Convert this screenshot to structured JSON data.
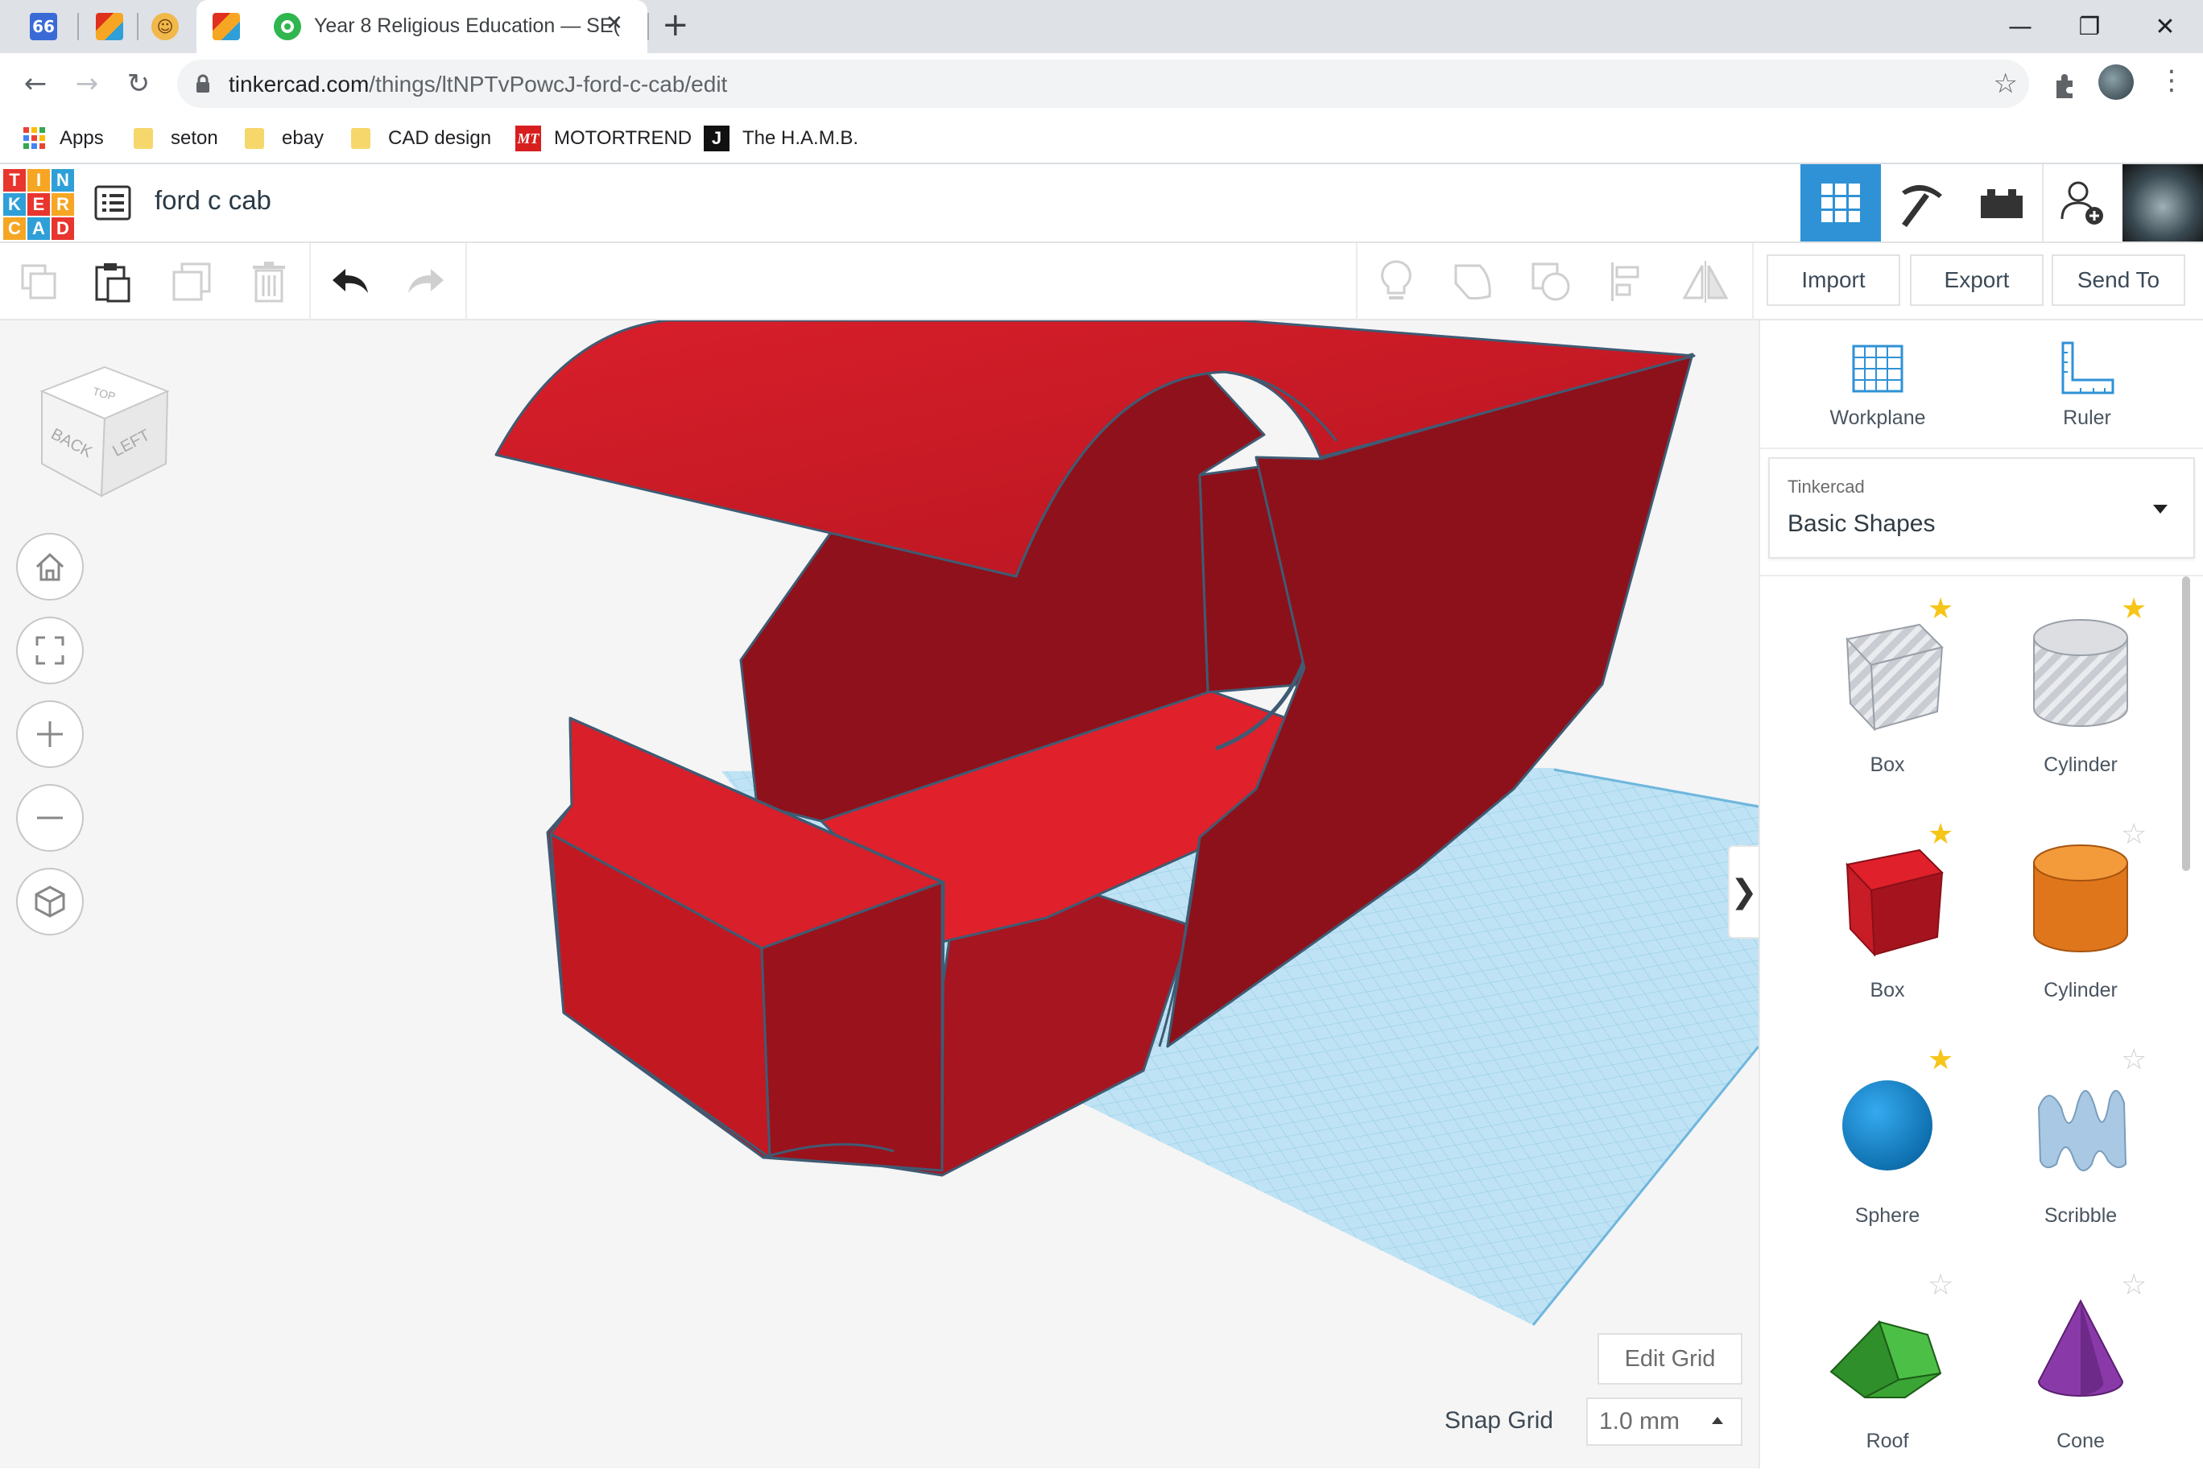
{
  "browser": {
    "tabs": [
      {
        "favicon_text": "66",
        "favicon_color": "#3a6ad6"
      },
      {
        "favicon_text": "TC",
        "favicon_color": "#e0301e"
      },
      {
        "favicon_text": "☺",
        "favicon_color": "#e6a228"
      },
      {
        "favicon_text": "TC",
        "favicon_color": "#e0301e",
        "active": true
      }
    ],
    "active_tab_title": "Year 8 Religious Education — SE(",
    "url_host": "tinkercad.com",
    "url_path": "/things/ltNPTvPowcJ-ford-c-cab/edit",
    "bookmarks": [
      "Apps",
      "seton",
      "ebay",
      "CAD design",
      "MOTORTREND",
      "The H.A.M.B."
    ],
    "window_controls": {
      "minimize": "—",
      "restore": "❐",
      "close": "✕"
    }
  },
  "app": {
    "logo_letters": [
      "T",
      "I",
      "N",
      "K",
      "E",
      "R",
      "C",
      "A",
      "D"
    ],
    "logo_colors": [
      "#e8352e",
      "#f6a623",
      "#2f9fd8",
      "#2f9fd8",
      "#e8352e",
      "#f6a623",
      "#f6a623",
      "#2f9fd8",
      "#e8352e"
    ],
    "project_title": "ford c cab",
    "accent": "#2f92d6"
  },
  "toolbar": {
    "import_label": "Import",
    "export_label": "Export",
    "send_to_label": "Send To"
  },
  "viewcube": {
    "top": "TOP",
    "back": "BACK",
    "left": "LEFT"
  },
  "workspace": {
    "edit_grid_label": "Edit Grid",
    "snap_grid_label": "Snap Grid",
    "snap_grid_value": "1.0 mm"
  },
  "panel": {
    "workplane_label": "Workplane",
    "ruler_label": "Ruler",
    "library_owner": "Tinkercad",
    "library_name": "Basic Shapes",
    "shapes": [
      {
        "label": "Box",
        "favorite": true
      },
      {
        "label": "Cylinder",
        "favorite": true
      },
      {
        "label": "Box",
        "favorite": true
      },
      {
        "label": "Cylinder",
        "favorite": false
      },
      {
        "label": "Sphere",
        "favorite": true
      },
      {
        "label": "Scribble",
        "favorite": false
      },
      {
        "label": "Roof",
        "favorite": false
      },
      {
        "label": "Cone",
        "favorite": false
      }
    ]
  }
}
